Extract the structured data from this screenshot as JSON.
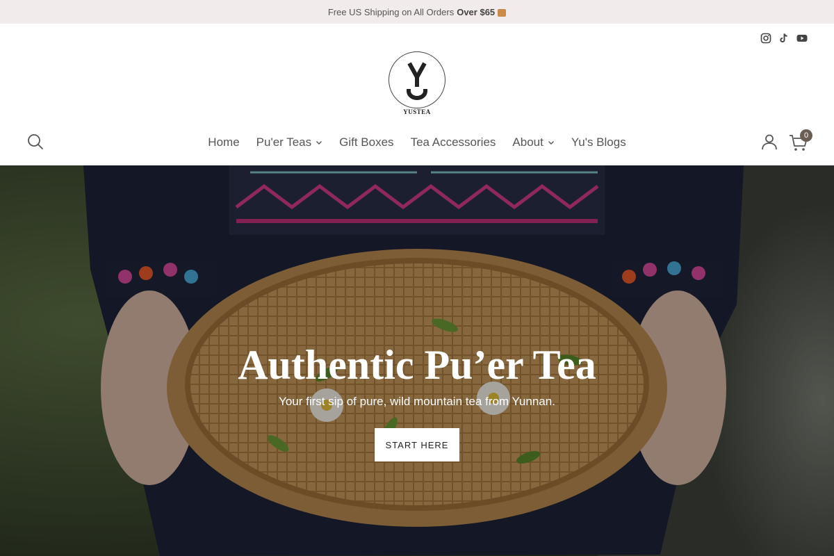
{
  "announcement": {
    "text": "Free US Shipping on All Orders",
    "highlight": "Over $65",
    "icon": "package-icon"
  },
  "social": {
    "icons": [
      "instagram-icon",
      "tiktok-icon",
      "youtube-icon"
    ]
  },
  "logo": {
    "text": "YUSTEA",
    "mark": "Y"
  },
  "nav": {
    "items": [
      {
        "label": "Home",
        "dropdown": false
      },
      {
        "label": "Pu'er Teas",
        "dropdown": true
      },
      {
        "label": "Gift Boxes",
        "dropdown": false
      },
      {
        "label": "Tea Accessories",
        "dropdown": false
      },
      {
        "label": "About",
        "dropdown": true
      },
      {
        "label": "Yu's Blogs",
        "dropdown": false
      }
    ]
  },
  "header_icons": {
    "search": "search-icon",
    "account": "user-icon",
    "cart": "cart-icon",
    "cart_count": "0"
  },
  "hero": {
    "title": "Authentic Pu’er Tea",
    "subtitle": "Your first sip of pure, wild mountain tea from Yunnan.",
    "button_label": "START HERE"
  },
  "colors": {
    "announcement_bg": "#f1ebeb",
    "cart_badge": "#6b5f55",
    "text": "#555555"
  }
}
